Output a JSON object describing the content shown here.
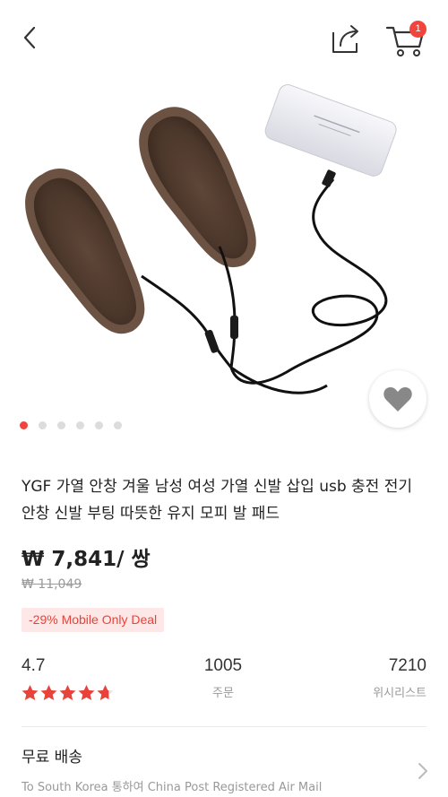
{
  "header": {
    "back_icon": "chevron-left-icon",
    "share_icon": "share-icon",
    "cart_icon": "cart-icon",
    "cart_count": "1",
    "badge_color": "#f0443c"
  },
  "gallery": {
    "image_count": 6,
    "active_index": 0,
    "wish_icon": "heart-icon"
  },
  "product": {
    "title": "YGF 가열 안창 겨울 남성 여성 가열 신발 삽입 usb 충전 전기 안창 신발 부팅 따뜻한 유지 모피 발 패드",
    "price": "₩ 7,841/ 쌍",
    "original_price": "₩ 11,049",
    "deal_badge": "-29% Mobile Only Deal"
  },
  "stats": {
    "rating": "4.7",
    "rating_stars": 4.7,
    "orders_count": "1005",
    "orders_label": "주문",
    "wishlist_count": "7210",
    "wishlist_label": "위시리스트"
  },
  "shipping": {
    "title": "무료 배송",
    "detail": "To South Korea 통하여 China Post Registered Air Mail"
  },
  "colors": {
    "accent": "#f0443c",
    "deal_bg": "#fde8e7",
    "star": "#e8433a"
  }
}
